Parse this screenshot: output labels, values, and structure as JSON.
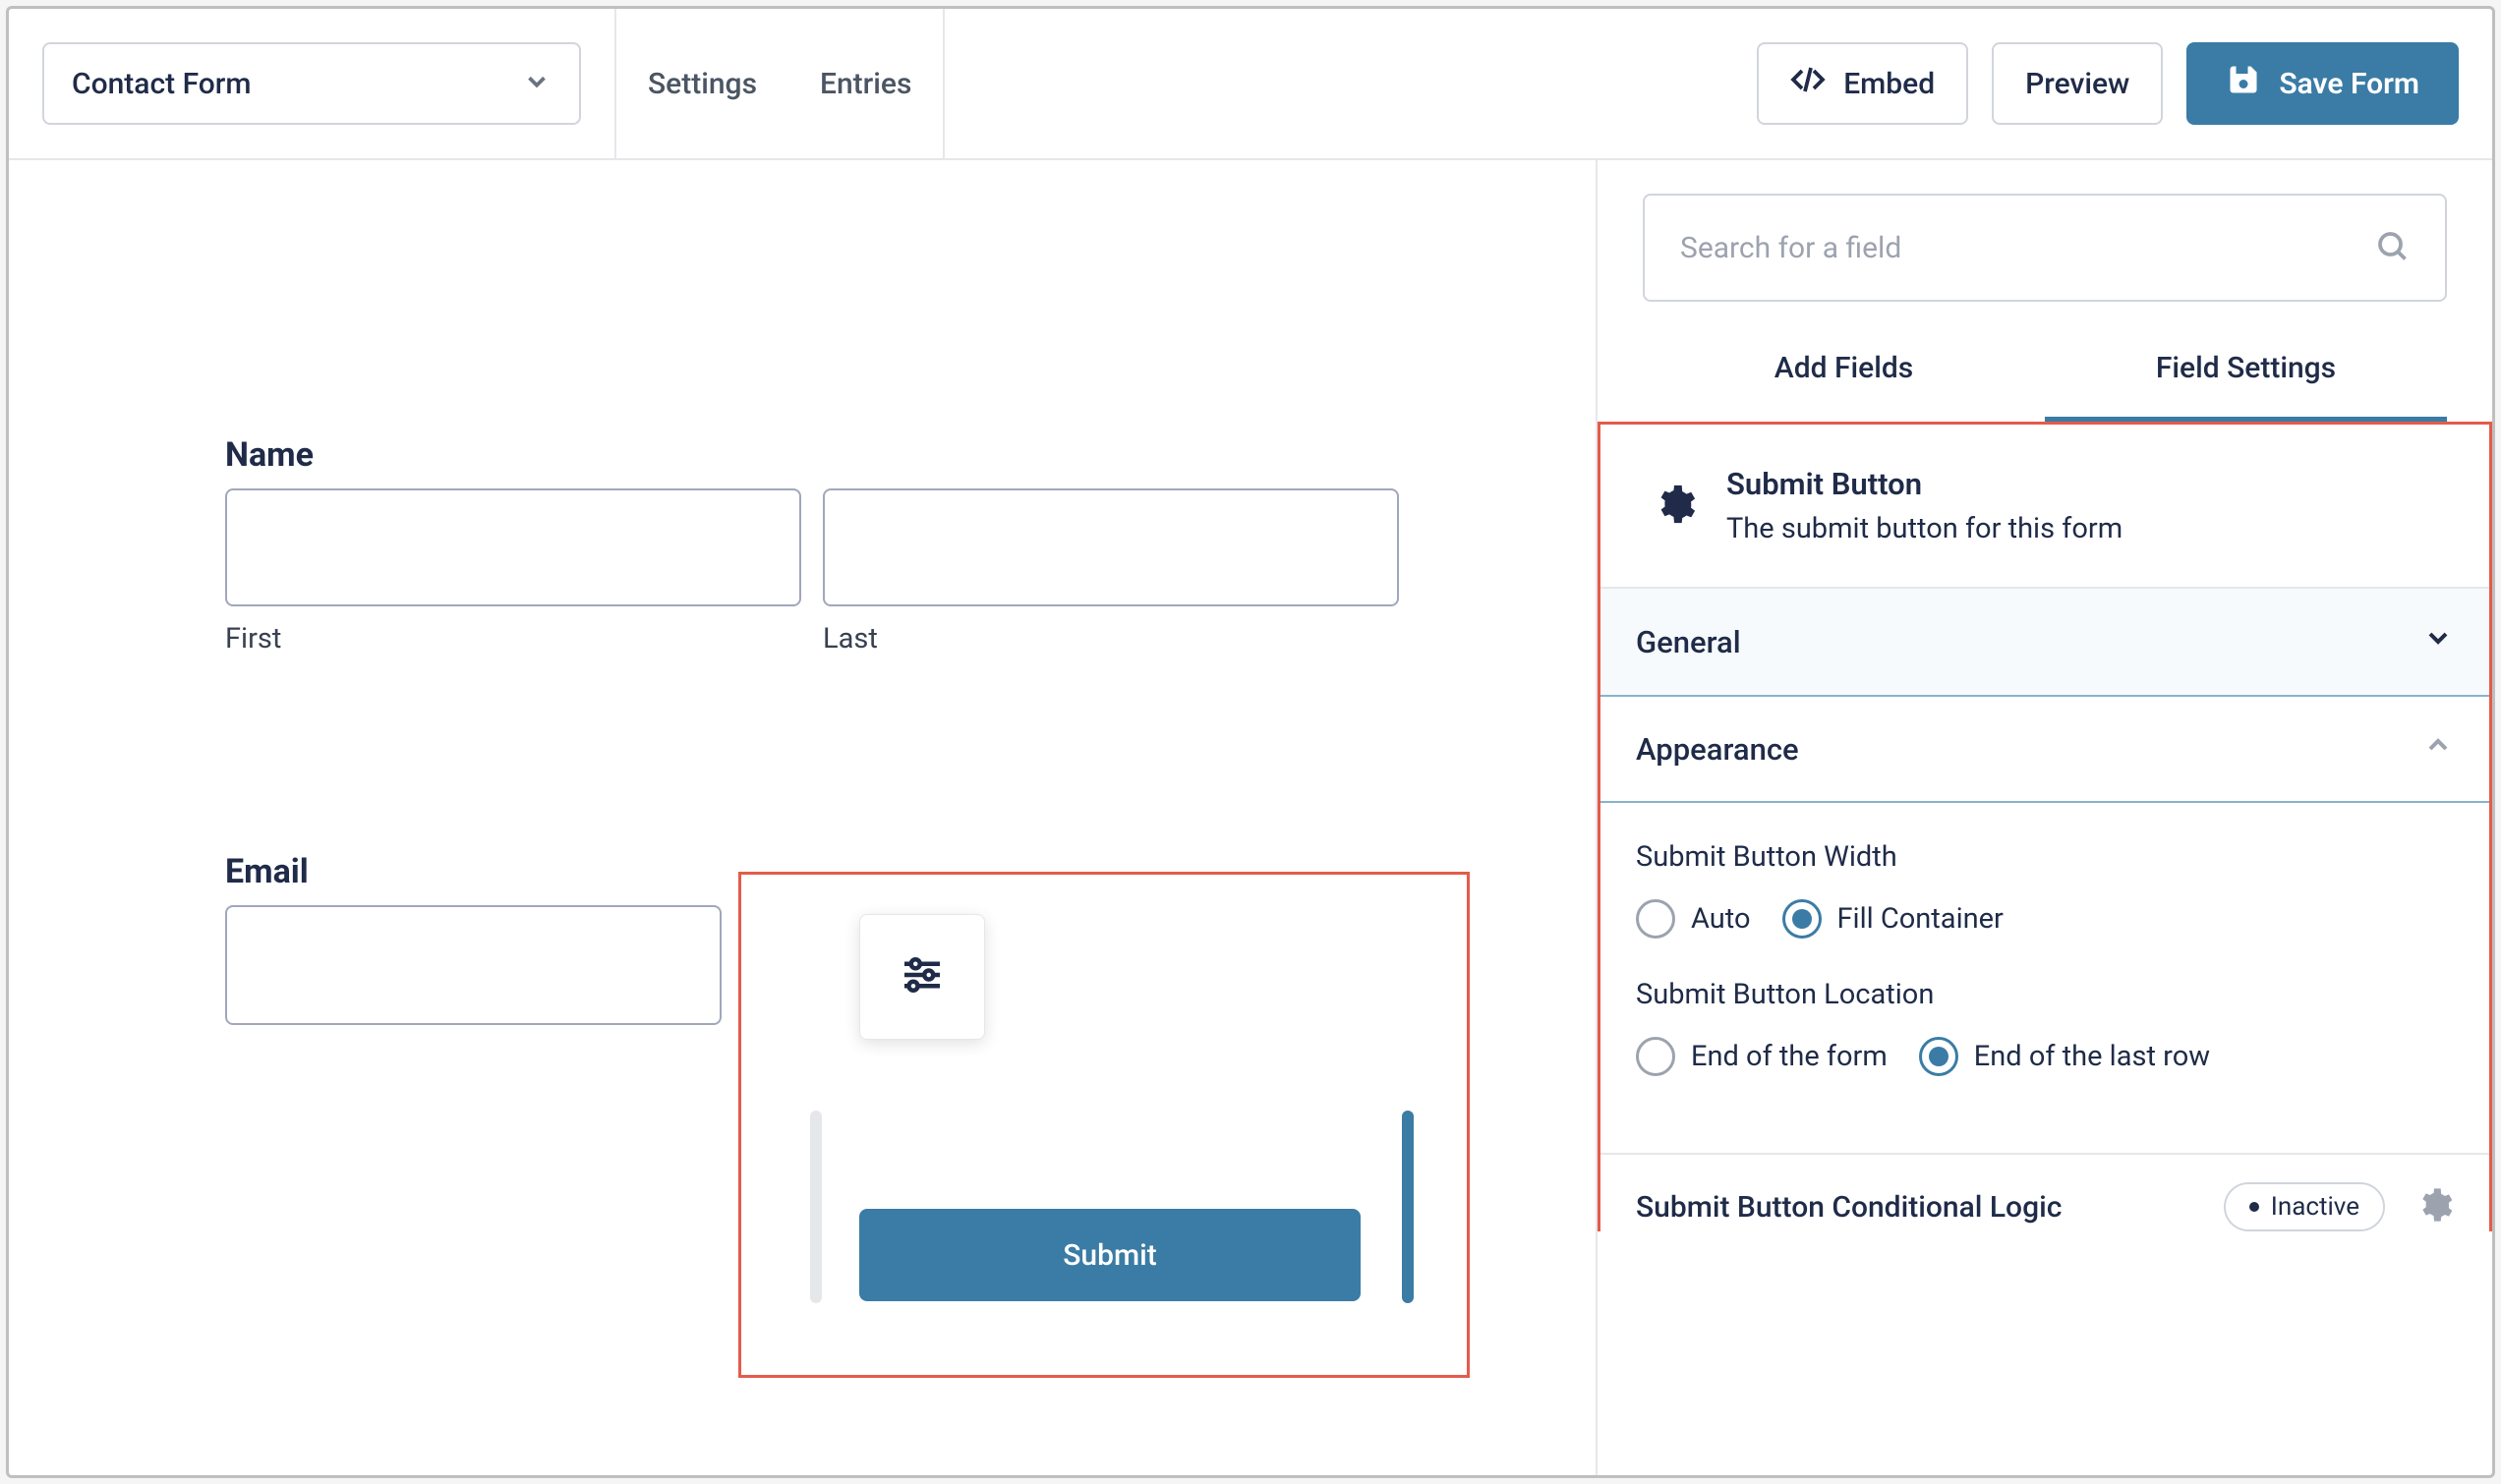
{
  "topbar": {
    "form_name": "Contact Form",
    "tabs": {
      "settings": "Settings",
      "entries": "Entries"
    },
    "embed": "Embed",
    "preview": "Preview",
    "save": "Save Form"
  },
  "canvas": {
    "name_label": "Name",
    "first_label": "First",
    "last_label": "Last",
    "email_label": "Email",
    "submit_label": "Submit"
  },
  "sidebar": {
    "search_placeholder": "Search for a field",
    "tabs": {
      "add_fields": "Add Fields",
      "field_settings": "Field Settings"
    },
    "field_title": "Submit Button",
    "field_desc": "The submit button for this form",
    "sections": {
      "general": "General",
      "appearance": "Appearance"
    },
    "appearance": {
      "width_label": "Submit Button Width",
      "width_options": {
        "auto": "Auto",
        "fill": "Fill Container"
      },
      "location_label": "Submit Button Location",
      "location_options": {
        "end_form": "End of the form",
        "end_row": "End of the last row"
      }
    },
    "logic": {
      "label": "Submit Button Conditional Logic",
      "status": "Inactive"
    }
  }
}
